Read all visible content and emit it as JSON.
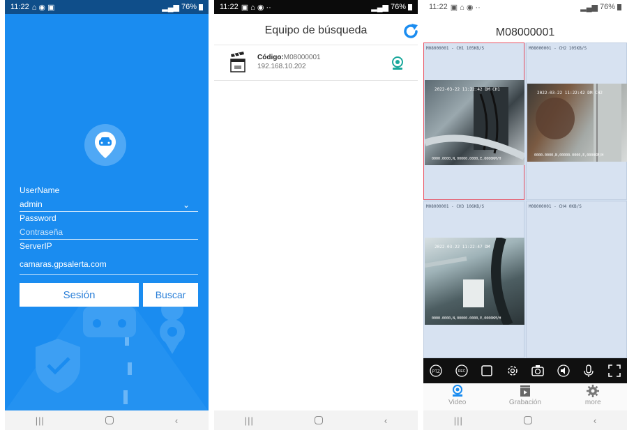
{
  "screen1": {
    "status_time": "11:22",
    "status_battery": "76%",
    "username_label": "UserName",
    "username_value": "admin",
    "password_label": "Password",
    "password_placeholder": "Contraseña",
    "serverip_label": "ServerIP",
    "serverip_value": "camaras.gpsalerta.com",
    "login_button": "Sesión",
    "search_button": "Buscar"
  },
  "screen2": {
    "status_time": "11:22",
    "status_battery": "76%",
    "title": "Equipo de búsqueda",
    "device": {
      "code_label": "Código:",
      "code_value": "M08000001",
      "ip": "192.168.10.202"
    }
  },
  "screen3": {
    "status_time": "11:22",
    "status_battery": "76%",
    "title": "M08000001",
    "channels": [
      {
        "label": "M08000001 - CH1 105KB/S",
        "timestamp": "2022-03-22 11:22:42 DM  CH1",
        "gps": "0000.0000,N,00000.0000,E,0000KM/H"
      },
      {
        "label": "M08000001 - CH2 105KB/S",
        "timestamp": "2022-03-22 11:22:42 DM  CH2",
        "gps": "0000.0000,N,00000.0000,E,0000KM/H"
      },
      {
        "label": "M08000001 - CH3 106KB/S",
        "timestamp": "2022-03-22 11:22:47 DM",
        "gps": "0000.0000,N,00000.0000,E,0000KM/H"
      },
      {
        "label": "M08000001 - CH4 0KB/S"
      }
    ],
    "tabs": [
      {
        "label": "Video",
        "icon": "camera-icon"
      },
      {
        "label": "Grabación",
        "icon": "clapperboard-icon"
      },
      {
        "label": "more",
        "icon": "gear-icon"
      }
    ],
    "toolbar_icons": [
      "ptz-icon",
      "rec-icon",
      "stop-icon",
      "settings-icon",
      "snapshot-icon",
      "speaker-icon",
      "mic-icon",
      "fullscreen-icon"
    ]
  },
  "colors": {
    "login_bg": "#1a8cf0",
    "accent": "#2a7fd8",
    "selection": "#e74d5f"
  }
}
